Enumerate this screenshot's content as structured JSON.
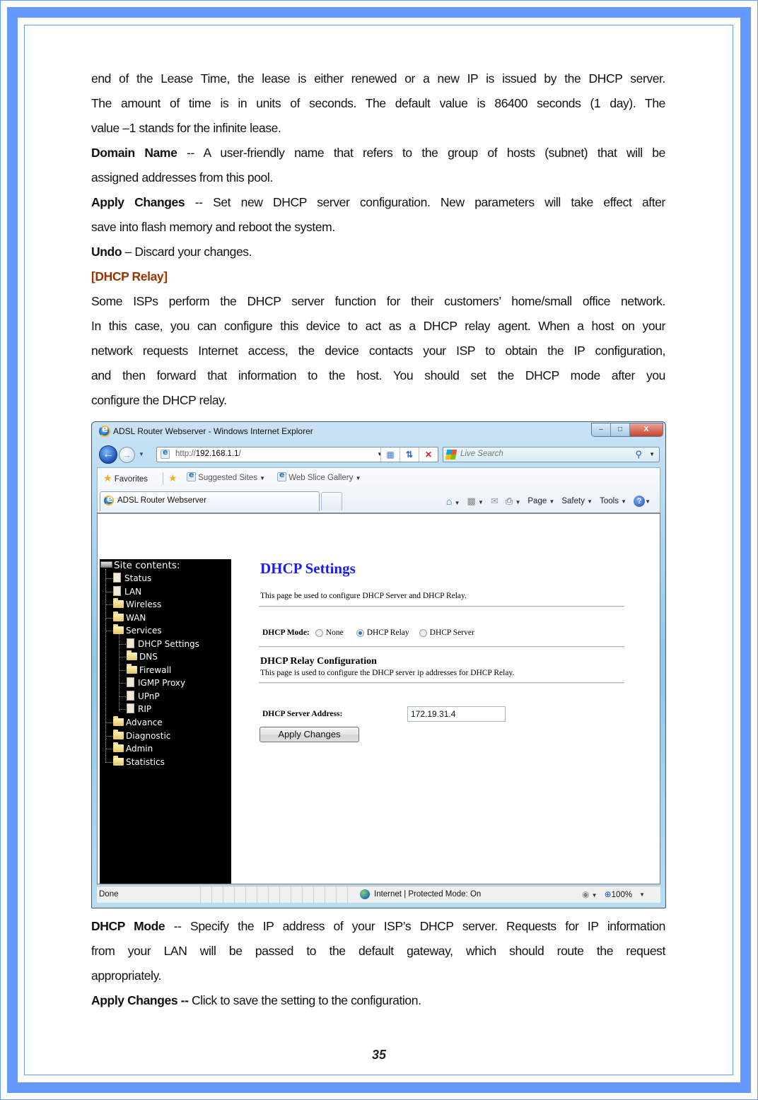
{
  "document": {
    "lines": [
      {
        "text": "end of the Lease Time, the lease is either renewed or a new IP is issued by the DHCP server.",
        "justify": true
      },
      {
        "text": "The amount of time is in units of seconds. The default value is 86400 seconds (1 day). The",
        "justify": true
      },
      {
        "text": "value –1 stands for the infinite lease.",
        "justify": false
      }
    ],
    "domain_name": {
      "term": "Domain Name",
      "sep": " -- ",
      "line1": "A user-friendly name that refers to the group of hosts (subnet) that will be",
      "line2": "assigned addresses from this pool."
    },
    "apply_changes_1": {
      "term": "Apply Changes",
      "sep": " -- ",
      "line1": "Set new DHCP server configuration. New parameters will take effect after",
      "line2": "save into flash memory and reboot the system."
    },
    "undo": {
      "term": "Undo",
      "sep": " – ",
      "text": "Discard your changes."
    },
    "relay_heading": "[DHCP Relay]",
    "relay_paragraph": [
      "Some ISPs perform the DHCP server function for their customers’ home/small office network.",
      "In this case, you can configure this device to act as a DHCP relay agent. When a host on your",
      "network requests Internet access, the device contacts your ISP to obtain the IP configuration,",
      "and then forward that information to the host. You should set the DHCP mode after you",
      "configure the DHCP relay."
    ],
    "dhcp_mode": {
      "term": "DHCP Mode",
      "sep": " -- ",
      "line1": "Specify the IP address of your ISP’s DHCP server. Requests for IP information",
      "line2": "from your LAN will be passed to the default gateway, which should route the request",
      "line3": "appropriately."
    },
    "apply_changes_2": {
      "term": "Apply Changes --",
      "text": " Click to save the setting to the configuration."
    },
    "page_number": "35"
  },
  "browser": {
    "window_title": "ADSL Router Webserver - Windows Internet Explorer",
    "window_buttons": {
      "minimize": "–",
      "maximize": "□",
      "close": "X"
    },
    "address": {
      "scheme": "http://",
      "host": "192.168.1.1",
      "path": "/"
    },
    "search_placeholder": "Live Search",
    "favorites": {
      "favorites_label": "Favorites",
      "suggested_sites": "Suggested Sites",
      "web_slice_gallery": "Web Slice Gallery"
    },
    "tab_title": "ADSL Router Webserver",
    "command_bar": {
      "page": "Page",
      "safety": "Safety",
      "tools": "Tools",
      "help": "?"
    },
    "status": {
      "left": "Done",
      "zone": "Internet | Protected Mode: On",
      "zoom": "100%"
    }
  },
  "router_page": {
    "tree": {
      "root": "Site contents:",
      "items": [
        {
          "label": "Status",
          "icon": "doc",
          "level": 1
        },
        {
          "label": "LAN",
          "icon": "doc",
          "level": 1
        },
        {
          "label": "Wireless",
          "icon": "folder",
          "level": 1
        },
        {
          "label": "WAN",
          "icon": "folder",
          "level": 1
        },
        {
          "label": "Services",
          "icon": "folder-open",
          "level": 1
        },
        {
          "label": "DHCP Settings",
          "icon": "doc",
          "level": 2
        },
        {
          "label": "DNS",
          "icon": "folder",
          "level": 2
        },
        {
          "label": "Firewall",
          "icon": "folder",
          "level": 2
        },
        {
          "label": "IGMP Proxy",
          "icon": "doc",
          "level": 2
        },
        {
          "label": "UPnP",
          "icon": "doc",
          "level": 2
        },
        {
          "label": "RIP",
          "icon": "doc",
          "level": 2
        },
        {
          "label": "Advance",
          "icon": "folder",
          "level": 1
        },
        {
          "label": "Diagnostic",
          "icon": "folder",
          "level": 1
        },
        {
          "label": "Admin",
          "icon": "folder",
          "level": 1
        },
        {
          "label": "Statistics",
          "icon": "folder",
          "level": 1
        }
      ]
    },
    "title": "DHCP Settings",
    "description": "This page be used to configure DHCP Server and DHCP Relay.",
    "mode_label": "DHCP Mode:",
    "mode_options": [
      {
        "label": "None",
        "checked": false
      },
      {
        "label": "DHCP Relay",
        "checked": true
      },
      {
        "label": "DHCP Server",
        "checked": false
      }
    ],
    "relay_title": "DHCP Relay Configuration",
    "relay_description": "This page is used to configure the DHCP server ip addresses for DHCP Relay.",
    "server_address_label": "DHCP Server Address:",
    "server_address_value": "172.19.31.4",
    "apply_button": "Apply Changes"
  },
  "colors": {
    "border": "#6699ff",
    "relay_heading": "#993300",
    "router_title": "#1a1aff"
  }
}
